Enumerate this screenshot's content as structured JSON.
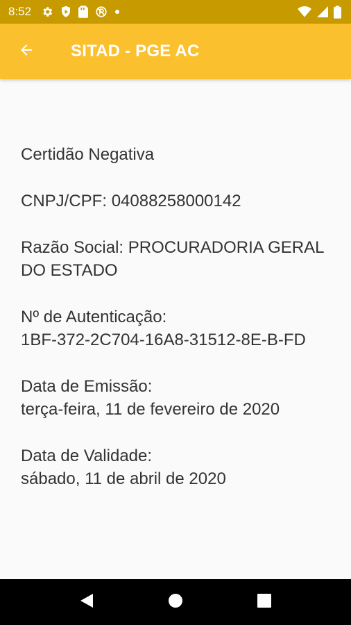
{
  "status_bar": {
    "time": "8:52",
    "icons": [
      "gear-icon",
      "shield-icon",
      "sim-card-icon",
      "no-sync-icon",
      "dot-icon",
      "wifi-icon",
      "signal-icon",
      "battery-icon"
    ]
  },
  "app_bar": {
    "title": "SITAD - PGE AC",
    "color": "#fbc02d"
  },
  "certificate": {
    "type_label": "Certidão Negativa",
    "cnpj_label": "CNPJ/CPF:",
    "cnpj_value": "04088258000142",
    "razao_label": "Razão Social:",
    "razao_value": "PROCURADORIA GERAL DO ESTADO",
    "auth_label": "Nº de Autenticação:",
    "auth_value": "1BF-372-2C704-16A8-31512-8E-B-FD",
    "emissao_label": "Data de Emissão:",
    "emissao_value": "terça-feira, 11 de fevereiro de 2020",
    "validade_label": "Data de Validade:",
    "validade_value": "sábado, 11 de abril de 2020"
  },
  "nav_bar": {
    "icons": [
      "back-triangle-icon",
      "home-circle-icon",
      "recents-square-icon"
    ]
  }
}
